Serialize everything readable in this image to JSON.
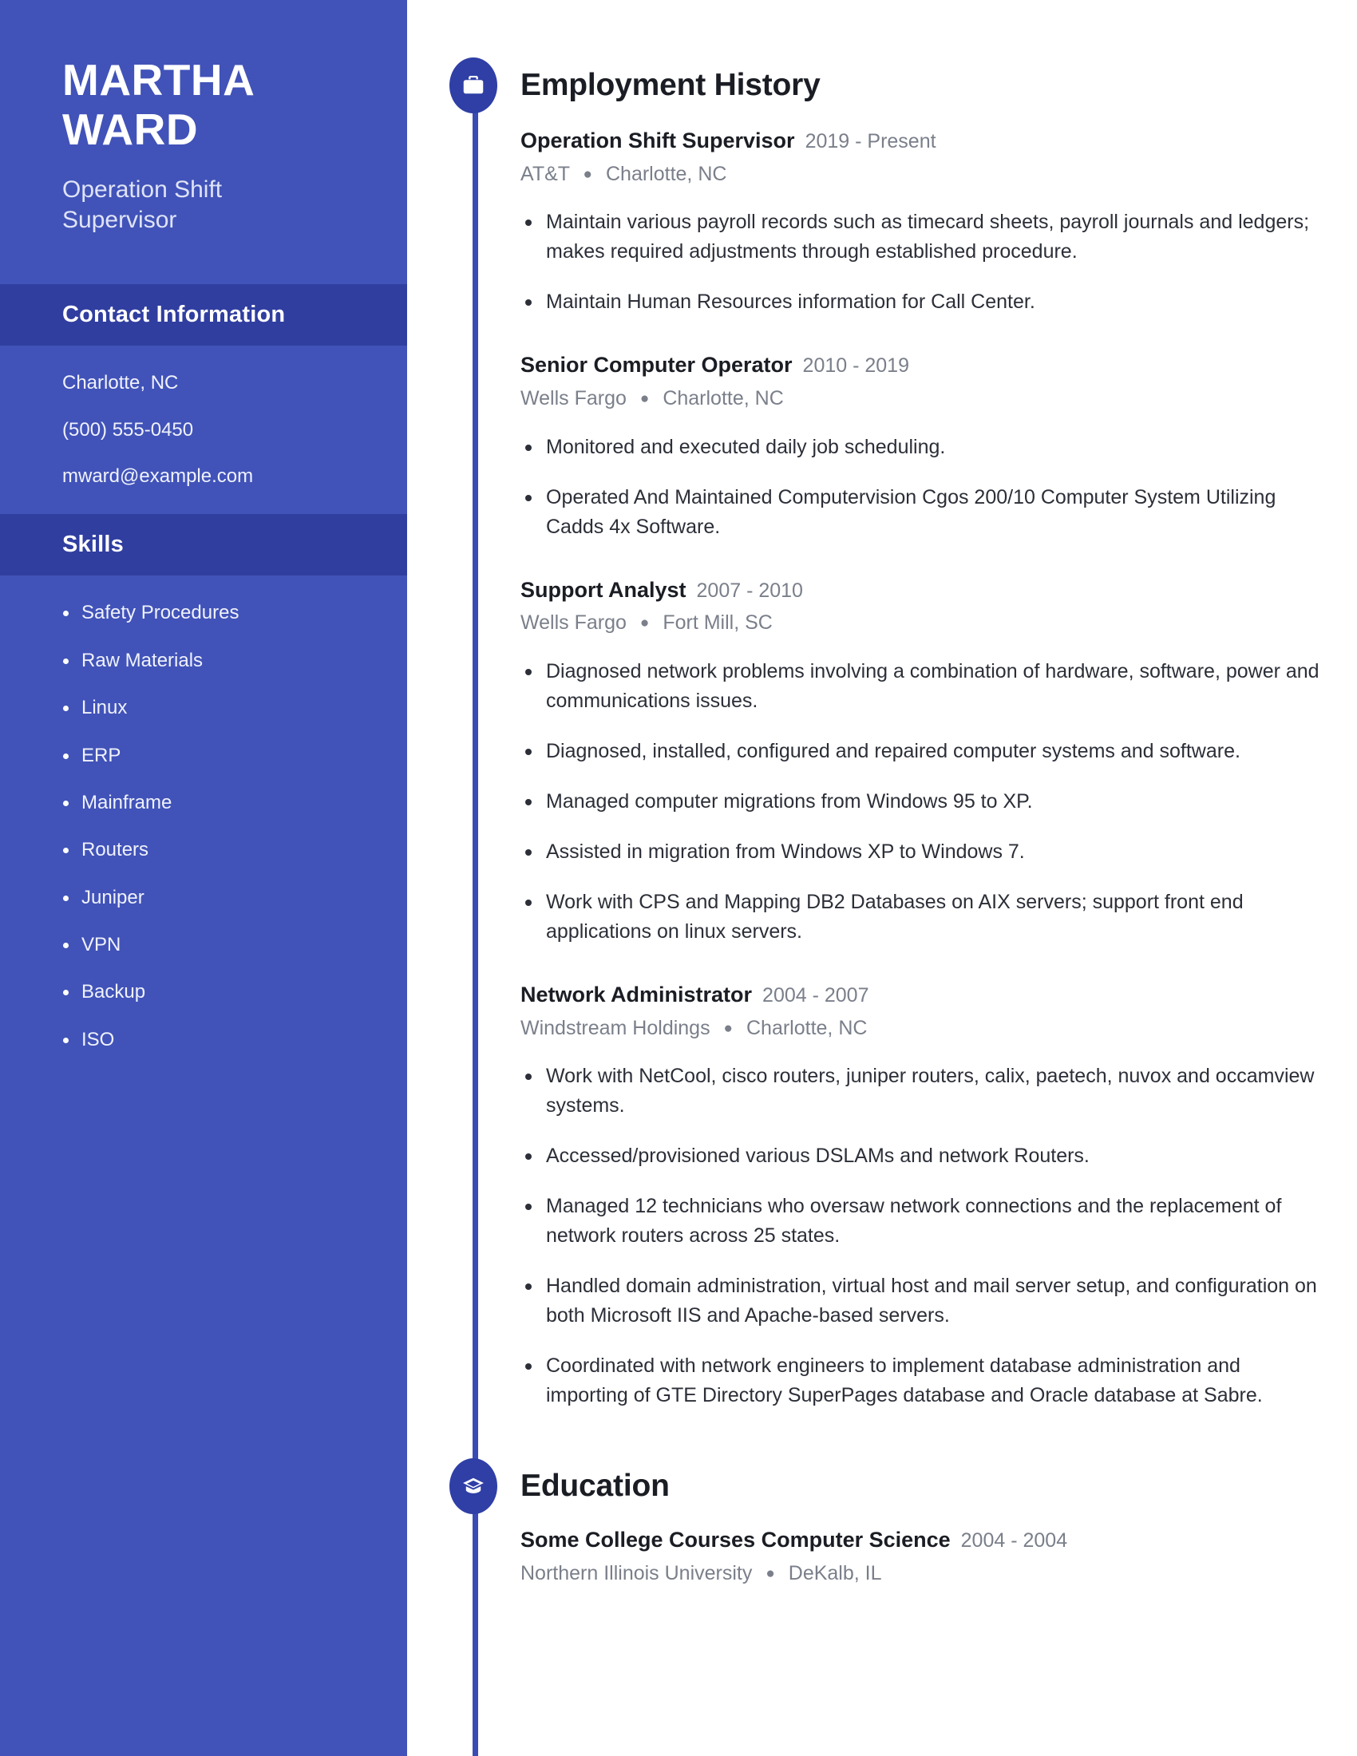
{
  "theme": {
    "sidebar_bg": "#4153b8",
    "sidebar_band_bg": "#303ea0",
    "accent": "#2f3fa6",
    "rail": "#3a4cb3",
    "text_dark": "#1b1d24",
    "text_muted": "#7a7f8a"
  },
  "sidebar": {
    "name": "MARTHA WARD",
    "headline": "Operation Shift Supervisor",
    "contact": {
      "heading": "Contact Information",
      "lines": [
        "Charlotte, NC",
        "(500) 555-0450",
        "mward@example.com"
      ]
    },
    "skills": {
      "heading": "Skills",
      "items": [
        "Safety Procedures",
        "Raw Materials",
        "Linux",
        "ERP",
        "Mainframe",
        "Routers",
        "Juniper",
        "VPN",
        "Backup",
        "ISO"
      ]
    }
  },
  "main": {
    "employment": {
      "heading": "Employment History",
      "icon": "briefcase-icon",
      "entries": [
        {
          "role": "Operation Shift Supervisor",
          "dates": "2019 - Present",
          "company": "AT&T",
          "location": "Charlotte, NC",
          "bullets": [
            "Maintain various payroll records such as timecard sheets, payroll journals and ledgers; makes required adjustments through established procedure.",
            "Maintain Human Resources information for Call Center."
          ]
        },
        {
          "role": "Senior Computer Operator",
          "dates": "2010 - 2019",
          "company": "Wells Fargo",
          "location": "Charlotte, NC",
          "bullets": [
            "Monitored and executed daily job scheduling.",
            "Operated And Maintained Computervision Cgos 200/10 Computer System Utilizing Cadds 4x Software."
          ]
        },
        {
          "role": "Support Analyst",
          "dates": "2007 - 2010",
          "company": "Wells Fargo",
          "location": "Fort Mill, SC",
          "bullets": [
            "Diagnosed network problems involving a combination of hardware, software, power and communications issues.",
            "Diagnosed, installed, configured and repaired computer systems and software.",
            "Managed computer migrations from Windows 95 to XP.",
            "Assisted in migration from Windows XP to Windows 7.",
            "Work with CPS and Mapping DB2 Databases on AIX servers; support front end applications on linux servers."
          ]
        },
        {
          "role": "Network Administrator",
          "dates": "2004 - 2007",
          "company": "Windstream Holdings",
          "location": "Charlotte, NC",
          "bullets": [
            "Work with NetCool, cisco routers, juniper routers, calix, paetech, nuvox and occamview systems.",
            "Accessed/provisioned various DSLAMs and network Routers.",
            "Managed 12 technicians who oversaw network connections and the replacement of network routers across 25 states.",
            "Handled domain administration, virtual host and mail server setup, and configuration on both Microsoft IIS and Apache-based servers.",
            "Coordinated with network engineers to implement database administration and importing of GTE Directory SuperPages database and Oracle database at Sabre."
          ]
        }
      ]
    },
    "education": {
      "heading": "Education",
      "icon": "graduation-cap-icon",
      "entries": [
        {
          "role": "Some College Courses Computer Science",
          "dates": "2004 - 2004",
          "company": "Northern Illinois University",
          "location": "DeKalb, IL",
          "bullets": []
        }
      ]
    }
  }
}
